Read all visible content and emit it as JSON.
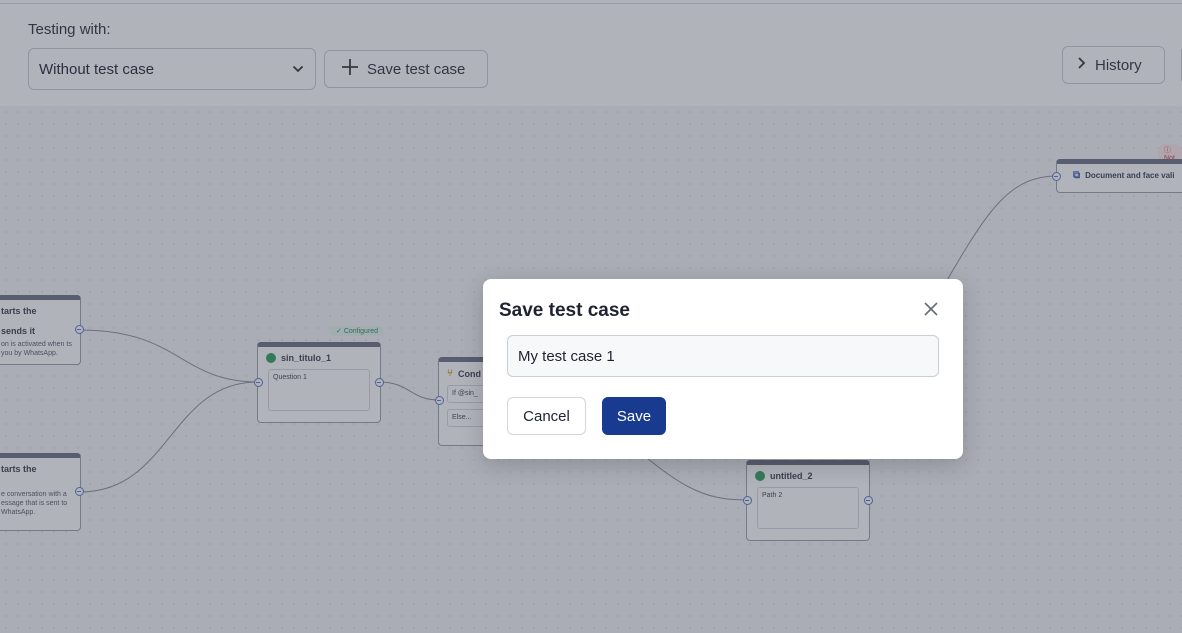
{
  "toolbar": {
    "testing_label": "Testing with:",
    "selected_test_case": "Without test case",
    "save_test_case_label": "Save test case",
    "history_label": "History"
  },
  "canvas": {
    "nodes": {
      "trigger1": {
        "title": "tarts the",
        "sub": "sends it",
        "body": "on is activated when ts you by WhatsApp."
      },
      "trigger2": {
        "title": "tarts the",
        "body": "e conversation with a essage that is sent to WhatsApp."
      },
      "question": {
        "badge": "Configured",
        "title": "sin_titulo_1",
        "inner": "Question 1"
      },
      "condition": {
        "title": "Cond",
        "if_text": "If @sin_",
        "else_text": "Else..."
      },
      "untitled": {
        "title": "untitled_2",
        "inner": "Path 2"
      },
      "document": {
        "badge": "Not",
        "title": "Document and face vali"
      }
    }
  },
  "modal": {
    "title": "Save test case",
    "input_value": "My test case 1",
    "cancel_label": "Cancel",
    "save_label": "Save"
  },
  "colors": {
    "primary": "#193b8f",
    "overlay": "#3c4254",
    "port": "#5a79c4",
    "configured": "#2e8b57",
    "error": "#d23b3b"
  }
}
